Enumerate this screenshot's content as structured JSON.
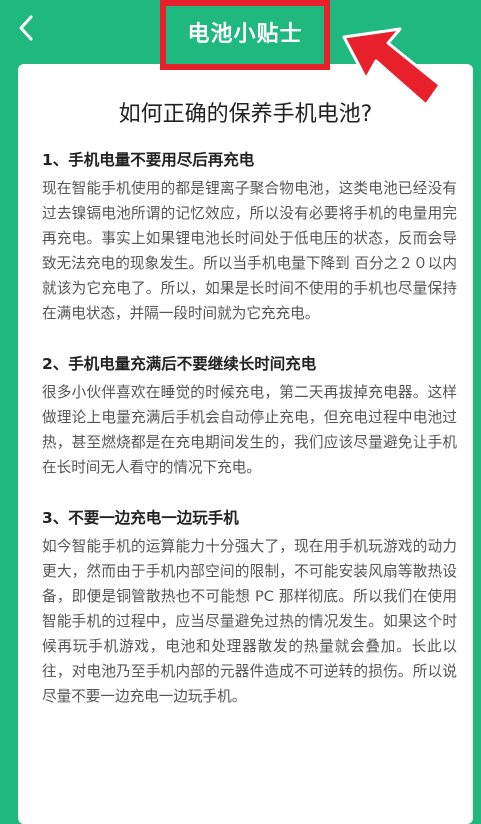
{
  "header": {
    "title": "电池小贴士",
    "back_icon": "chevron-left-icon"
  },
  "colors": {
    "header_bg": "#1fb87f",
    "highlight_red": "#e8202b",
    "card_bg": "#ffffff"
  },
  "article": {
    "title": "如何正确的保养手机电池?",
    "sections": [
      {
        "heading": "1、手机电量不要用尽后再充电",
        "body": "现在智能手机使用的都是锂离子聚合物电池，这类电池已经没有过去镍镉电池所谓的记忆效应，所以没有必要将手机的电量用完再充电。事实上如果锂电池长时间处于低电压的状态，反而会导致无法充电的现象发生。所以当手机电量下降到 百分之２０以内就该为它充电了。所以，如果是长时间不使用的手机也尽量保持在满电状态，并隔一段时间就为它充充电。"
      },
      {
        "heading": "2、手机电量充满后不要继续长时间充电",
        "body": "很多小伙伴喜欢在睡觉的时候充电，第二天再拔掉充电器。这样做理论上电量充满后手机会自动停止充电，但充电过程中电池过热，甚至燃烧都是在充电期间发生的，我们应该尽量避免让手机在长时间无人看守的情况下充电。"
      },
      {
        "heading": "3、不要一边充电一边玩手机",
        "body": "如今智能手机的运算能力十分强大了，现在用手机玩游戏的动力更大，然而由于手机内部空间的限制，不可能安装风扇等散热设备，即便是铜管散热也不可能想 PC 那样彻底。所以我们在使用智能手机的过程中，应当尽量避免过热的情况发生。如果这个时候再玩手机游戏，电池和处理器散发的热量就会叠加。长此以往，对电池乃至手机内部的元器件造成不可逆转的损伤。所以说尽量不要一边充电一边玩手机。"
      }
    ]
  }
}
